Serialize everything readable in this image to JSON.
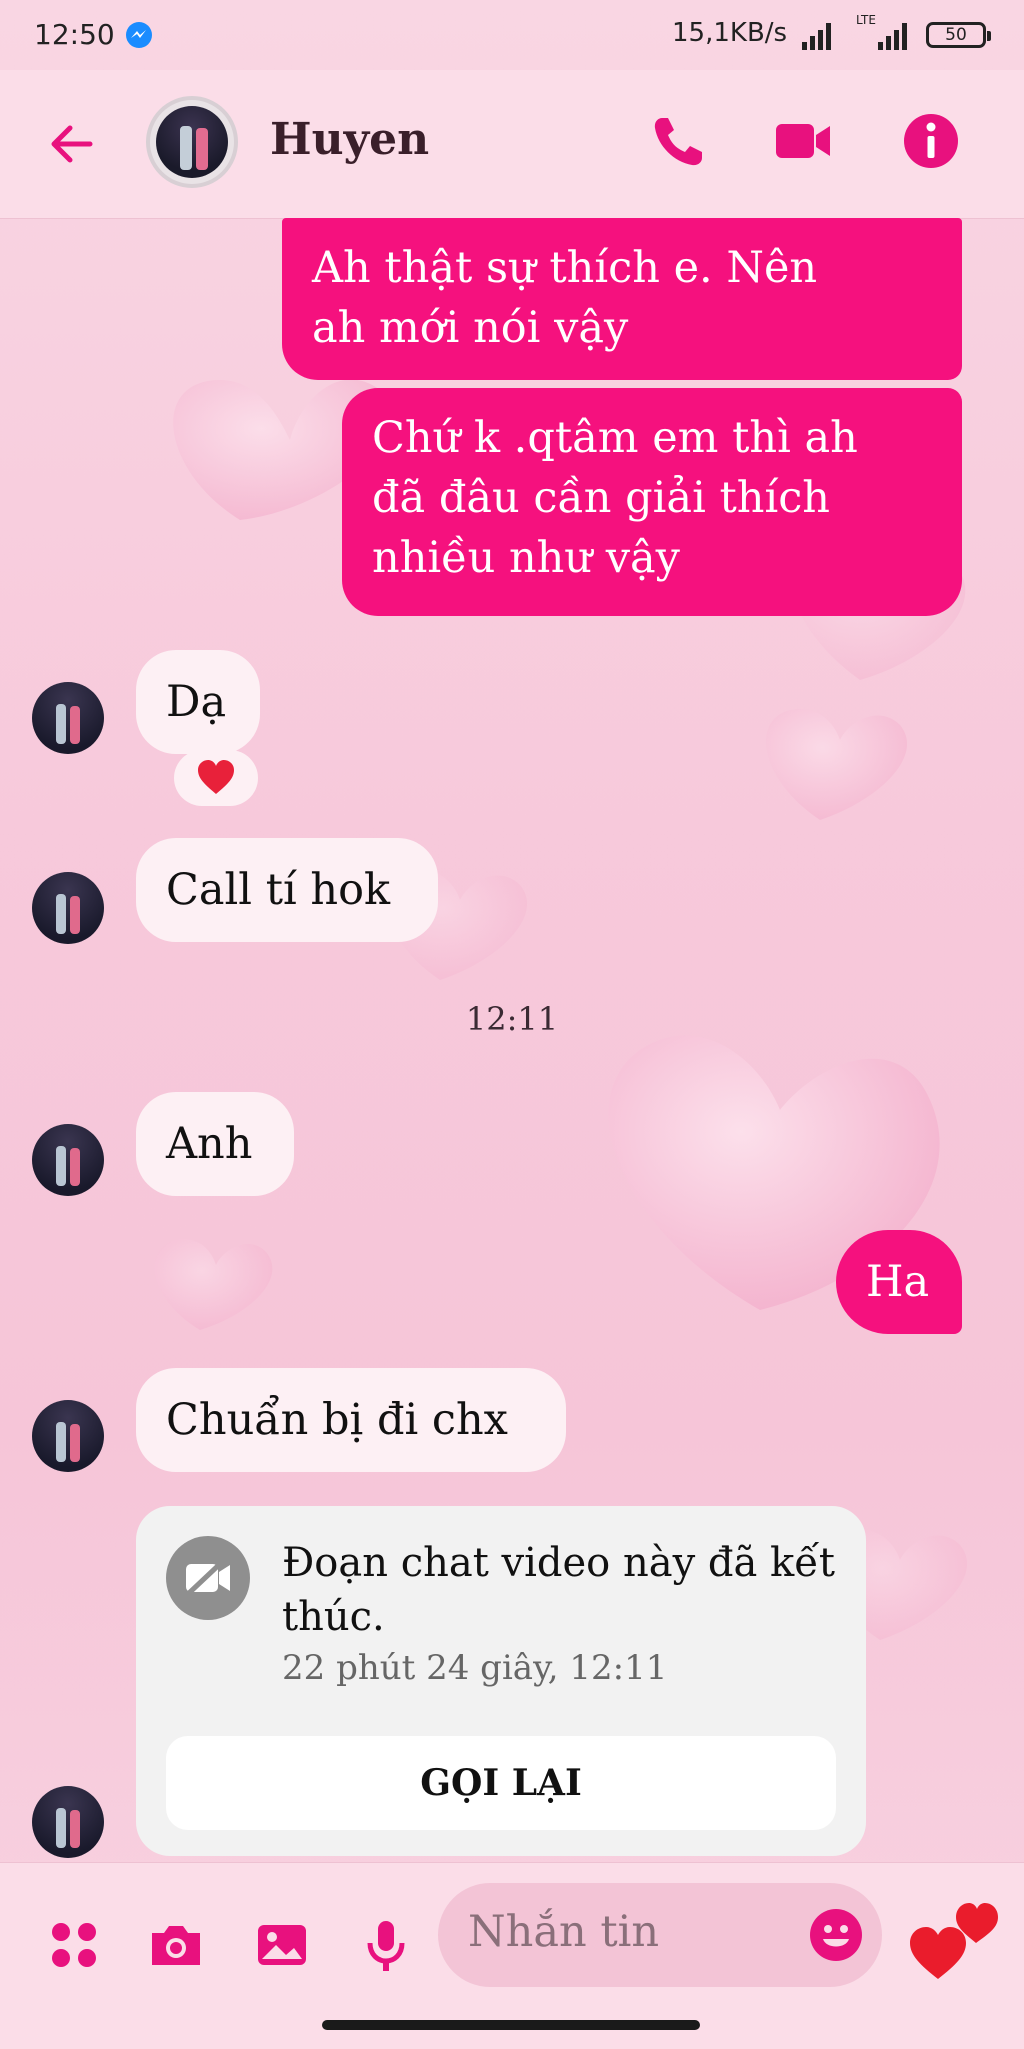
{
  "status_bar": {
    "time": "12:50",
    "net_speed": "15,1KB/s",
    "network_type": "LTE",
    "battery": "50"
  },
  "header": {
    "contact_name": "Huyen"
  },
  "messages": [
    {
      "from": "me",
      "text": "Ah thật sự  thích  e. Nên\nah mới nói vậy"
    },
    {
      "from": "me",
      "text": "Chứ k .qtâm em thì   ah\nđã đâu  cần giải thích\nnhiều như vậy"
    },
    {
      "from": "them",
      "text": "Dạ",
      "reaction": "❤️"
    },
    {
      "from": "them",
      "text": "Call tí hok"
    },
    {
      "from": "them",
      "text": "Anh"
    },
    {
      "from": "me",
      "text": "Ha"
    },
    {
      "from": "them",
      "text": "Chuẩn bị đi chx"
    }
  ],
  "timestamp": "12:11",
  "video_call": {
    "title": "Đoạn chat video này đã kết thúc.",
    "subtitle": "22 phút 24 giây, 12:11",
    "button": "GỌI LẠI"
  },
  "composer": {
    "placeholder": "Nhắn tin"
  },
  "colors": {
    "accent": "#f5117e",
    "header_bg": "#fbdde8",
    "incoming_bubble": "#fdf0f4"
  }
}
